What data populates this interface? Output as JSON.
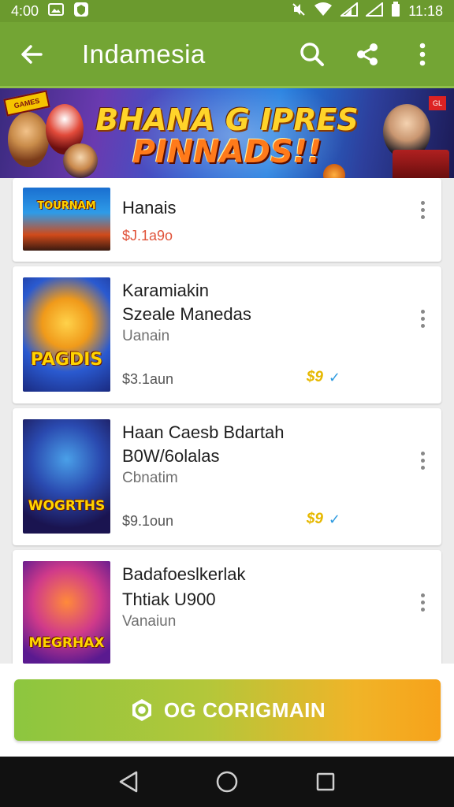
{
  "status": {
    "time_left": "4:00",
    "time_right": "11:18"
  },
  "app_bar": {
    "title": "Indamesia"
  },
  "banner": {
    "line1": "BHANA G IPRES",
    "line2": "PINNADS!!",
    "corner_logo": "GAMES",
    "corner_badge": "GL"
  },
  "items": [
    {
      "name": "Hanais",
      "price": "$J.1a9o",
      "thumb_text": "TOURNAM"
    },
    {
      "name": "Karamiakin",
      "name2": "Szeale Manedas",
      "sub": "Uanain",
      "price": "$3.1aun",
      "rating": "$9",
      "check": "✓",
      "thumb_text": "PAGDIS"
    },
    {
      "name": "Haan Caesb Bdartah",
      "name2": "B0W/6olalas",
      "sub": "Cbnatim",
      "price": "$9.1oun",
      "rating": "$9",
      "check": "✓",
      "thumb_text": "WOGRTHS"
    },
    {
      "name": "Badafoeslkerlak",
      "name2": "Thtiak U900",
      "sub": "Vanaiun",
      "thumb_text": "MEGRHAX"
    }
  ],
  "cta": {
    "label": "OG CORIGMAIN"
  },
  "colors": {
    "app_bar": "#73a534",
    "status_bar": "#6b9a2e",
    "cta_start": "#8cc63f",
    "cta_end": "#f7a21a"
  }
}
